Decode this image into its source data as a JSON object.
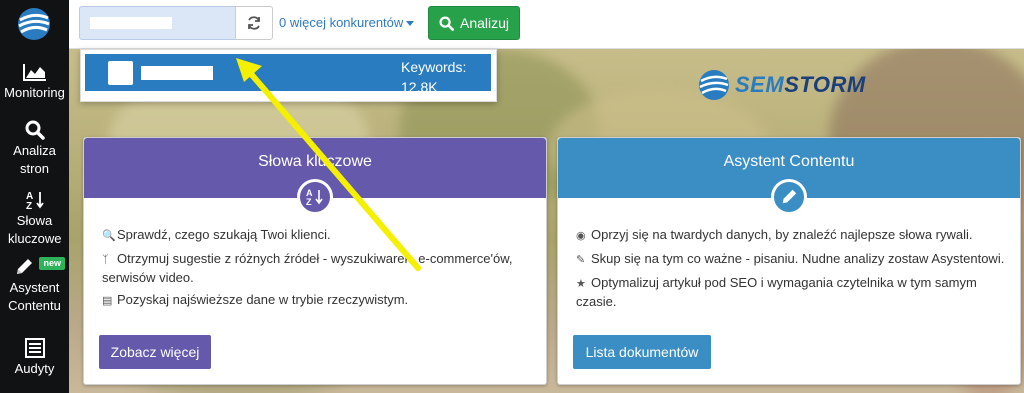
{
  "sidebar": {
    "items": [
      {
        "label": "Monitoring",
        "icon": "chart-area-icon"
      },
      {
        "label": "Analiza stron",
        "icon": "search-icon"
      },
      {
        "label": "Słowa kluczowe",
        "icon": "sort-alpha-icon"
      },
      {
        "label": "Asystent Contentu",
        "icon": "pencil-icon",
        "badge": "new"
      },
      {
        "label": "Audyty",
        "icon": "list-icon"
      }
    ]
  },
  "topbar": {
    "competitors_label": "0 więcej konkurentów",
    "analyze_label": "Analizuj"
  },
  "dropdown": {
    "keywords_label": "Keywords:",
    "keywords_value": "12.8K"
  },
  "brand": {
    "sem": "SEM",
    "storm": "STORM"
  },
  "cards": [
    {
      "title": "Słowa kluczowe",
      "color": "#6459ab",
      "icon": "sort-alpha-icon",
      "features": [
        {
          "icon": "search-icon",
          "text": "Sprawdź, czego szukają Twoi klienci."
        },
        {
          "icon": "branch-icon",
          "text": "Otrzymuj sugestie z różnych źródeł - wyszukiwarek, e-commerce'ów, serwisów video."
        },
        {
          "icon": "news-icon",
          "text": "Pozyskaj najświeższe dane w trybie rzeczywistym."
        }
      ],
      "button": "Zobacz więcej"
    },
    {
      "title": "Asystent Contentu",
      "color": "#3a8ec4",
      "icon": "pencil-icon",
      "features": [
        {
          "icon": "target-icon",
          "text": "Oprzyj się na twardych danych, by znaleźć najlepsze słowa rywali."
        },
        {
          "icon": "edit-icon",
          "text": "Skup się na tym co ważne - pisaniu. Nudne analizy zostaw Asystentowi."
        },
        {
          "icon": "trophy-icon",
          "text": "Optymalizuj artykuł pod SEO i wymagania czytelnika w tym samym czasie."
        }
      ],
      "button": "Lista dokumentów"
    }
  ]
}
